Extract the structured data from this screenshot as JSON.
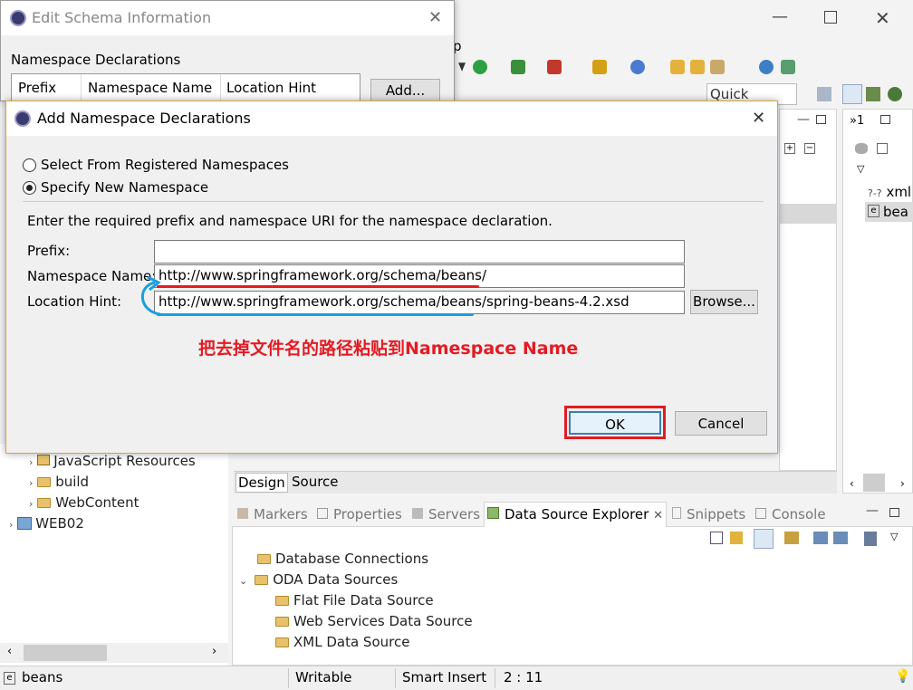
{
  "background_window": {
    "menu_partial": "p",
    "quick_access": "Quick Access",
    "right_panel": {
      "items": [
        "xml",
        "bea"
      ],
      "marker": "»1"
    },
    "editor_tabs": [
      "Design",
      "Source"
    ],
    "left_tree": [
      {
        "label": "JavaScript Resources",
        "indent": 1
      },
      {
        "label": "build",
        "indent": 1
      },
      {
        "label": "WebContent",
        "indent": 1
      },
      {
        "label": "WEB02",
        "indent": 0
      }
    ],
    "bottom_tabs": [
      "Markers",
      "Properties",
      "Servers",
      "Data Source Explorer",
      "Snippets",
      "Console"
    ],
    "bottom_tree": [
      {
        "label": "Database Connections",
        "indent": 0
      },
      {
        "label": "ODA Data Sources",
        "indent": 0
      },
      {
        "label": "Flat File Data Source",
        "indent": 1
      },
      {
        "label": "Web Services Data Source",
        "indent": 1
      },
      {
        "label": "XML Data Source",
        "indent": 1
      }
    ],
    "status": {
      "file": "beans",
      "mode": "Writable",
      "insert": "Smart Insert",
      "pos": "2 : 11"
    }
  },
  "schema_dialog": {
    "title": "Edit Schema Information",
    "section_label": "Namespace Declarations",
    "columns": [
      "Prefix",
      "Namespace Name",
      "Location Hint"
    ],
    "add_button": "Add..."
  },
  "add_dialog": {
    "title": "Add Namespace Declarations",
    "radio_registered": "Select From Registered Namespaces",
    "radio_new": "Specify New Namespace",
    "instruction": "Enter the required prefix and namespace URI for the namespace declaration.",
    "prefix_label": "Prefix:",
    "prefix_value": "",
    "namespace_label": "Namespace Name:",
    "namespace_value": "http://www.springframework.org/schema/beans/",
    "location_label": "Location Hint:",
    "location_value": "http://www.springframework.org/schema/beans/spring-beans-4.2.xsd",
    "browse_button": "Browse...",
    "ok_button": "OK",
    "cancel_button": "Cancel"
  },
  "annotation": {
    "text": "把去掉文件名的路径粘贴到Namespace Name",
    "color": "#e31b23",
    "arrow_color": "#1a9ee0"
  }
}
